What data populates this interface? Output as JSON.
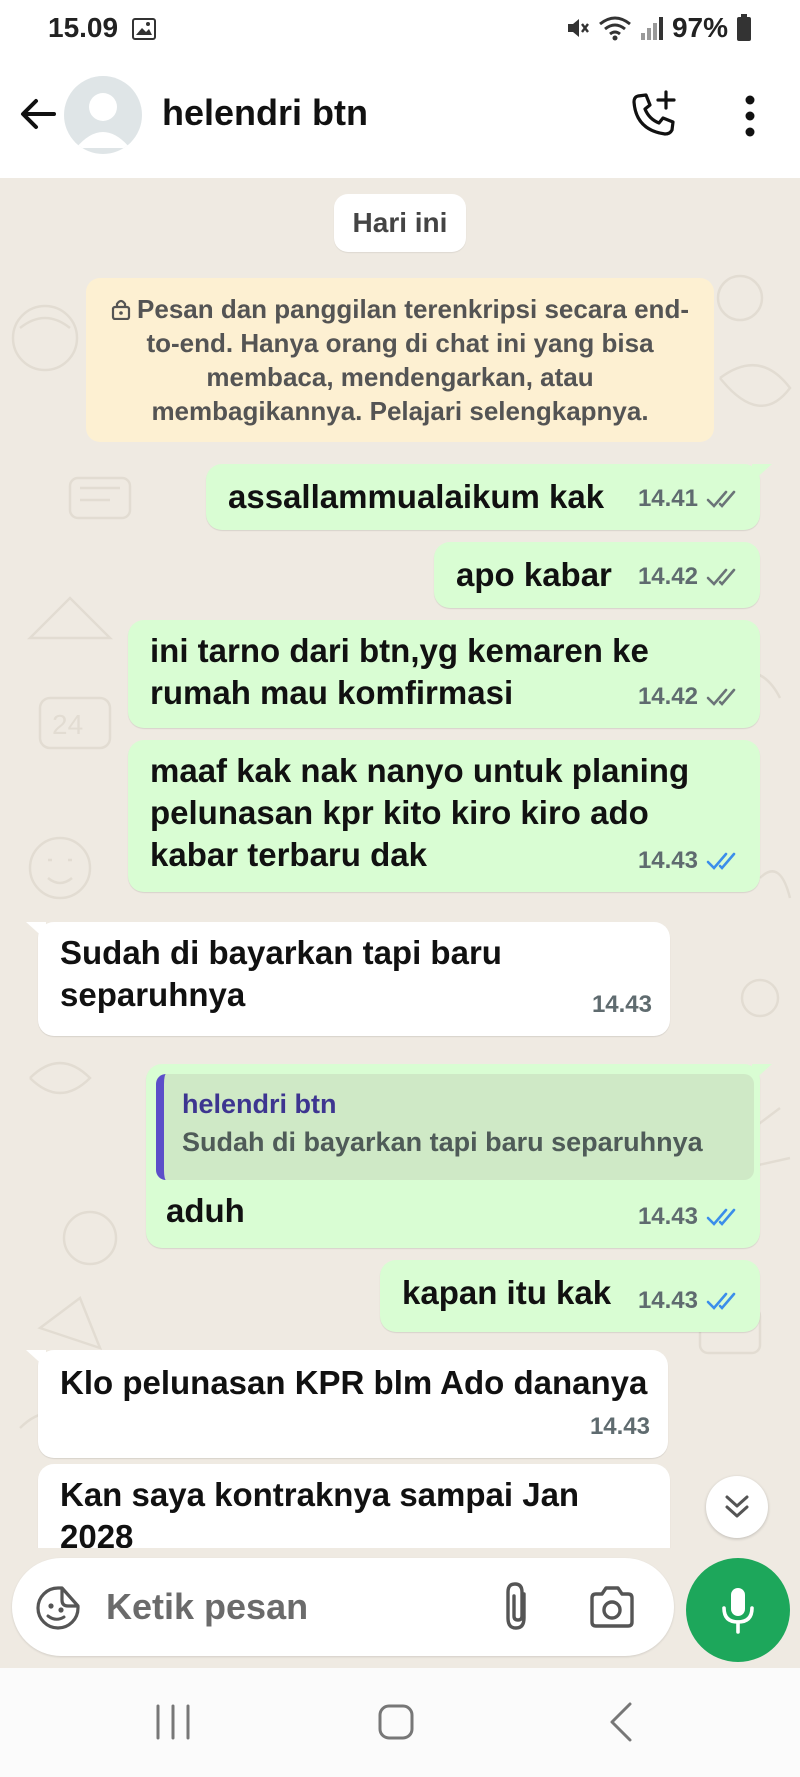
{
  "status_bar": {
    "time": "15.09",
    "battery": "97%"
  },
  "header": {
    "contact_name": "helendri btn"
  },
  "chat": {
    "date_chip": "Hari ini",
    "encryption_notice": "Pesan dan panggilan terenkripsi secara end-to-end. Hanya orang di chat ini yang bisa membaca, mendengarkan, atau membagikannya. Pelajari selengkapnya.",
    "messages": [
      {
        "direction": "out",
        "line1": "assallammualaikum kak",
        "time": "14.41",
        "status": "delivered"
      },
      {
        "direction": "out",
        "line1": "apo kabar",
        "time": "14.42",
        "status": "delivered"
      },
      {
        "direction": "out",
        "line1": "ini tarno dari btn,yg kemaren ke",
        "line2": "rumah mau komfirmasi",
        "time": "14.42",
        "status": "delivered"
      },
      {
        "direction": "out",
        "line1": "maaf kak nak nanyo untuk planing",
        "line2": "pelunasan kpr kito kiro kiro ado",
        "line3": "kabar terbaru dak",
        "time": "14.43",
        "status": "read"
      },
      {
        "direction": "in",
        "line1": "Sudah di bayarkan tapi baru",
        "line2": "separuhnya",
        "time": "14.43"
      },
      {
        "direction": "out",
        "quote_name": "helendri btn",
        "quote_text": "Sudah di bayarkan tapi baru separuhnya",
        "line1": "aduh",
        "time": "14.43",
        "status": "read"
      },
      {
        "direction": "out",
        "line1": "kapan itu kak",
        "time": "14.43",
        "status": "read"
      },
      {
        "direction": "in",
        "line1": "Klo pelunasan KPR blm Ado dananya",
        "time": "14.43"
      },
      {
        "direction": "in",
        "line1": "Kan saya kontraknya sampai Jan",
        "line2": "2028"
      }
    ]
  },
  "input": {
    "placeholder": "Ketik pesan"
  },
  "colors": {
    "outgoing_bubble": "#d9fdd3",
    "incoming_bubble": "#ffffff",
    "chat_background": "#efeae2",
    "read_tick": "#3b8eea",
    "mic_button": "#1da75b",
    "quote_bar": "#5c4ec9"
  },
  "icons": [
    "back-arrow-icon",
    "avatar-placeholder-icon",
    "add-call-icon",
    "more-vert-icon",
    "lock-icon",
    "double-check-icon",
    "scroll-down-icon",
    "emoji-sticker-icon",
    "attach-icon",
    "camera-icon",
    "mic-icon",
    "nav-recent-icon",
    "nav-home-icon",
    "nav-back-icon"
  ]
}
